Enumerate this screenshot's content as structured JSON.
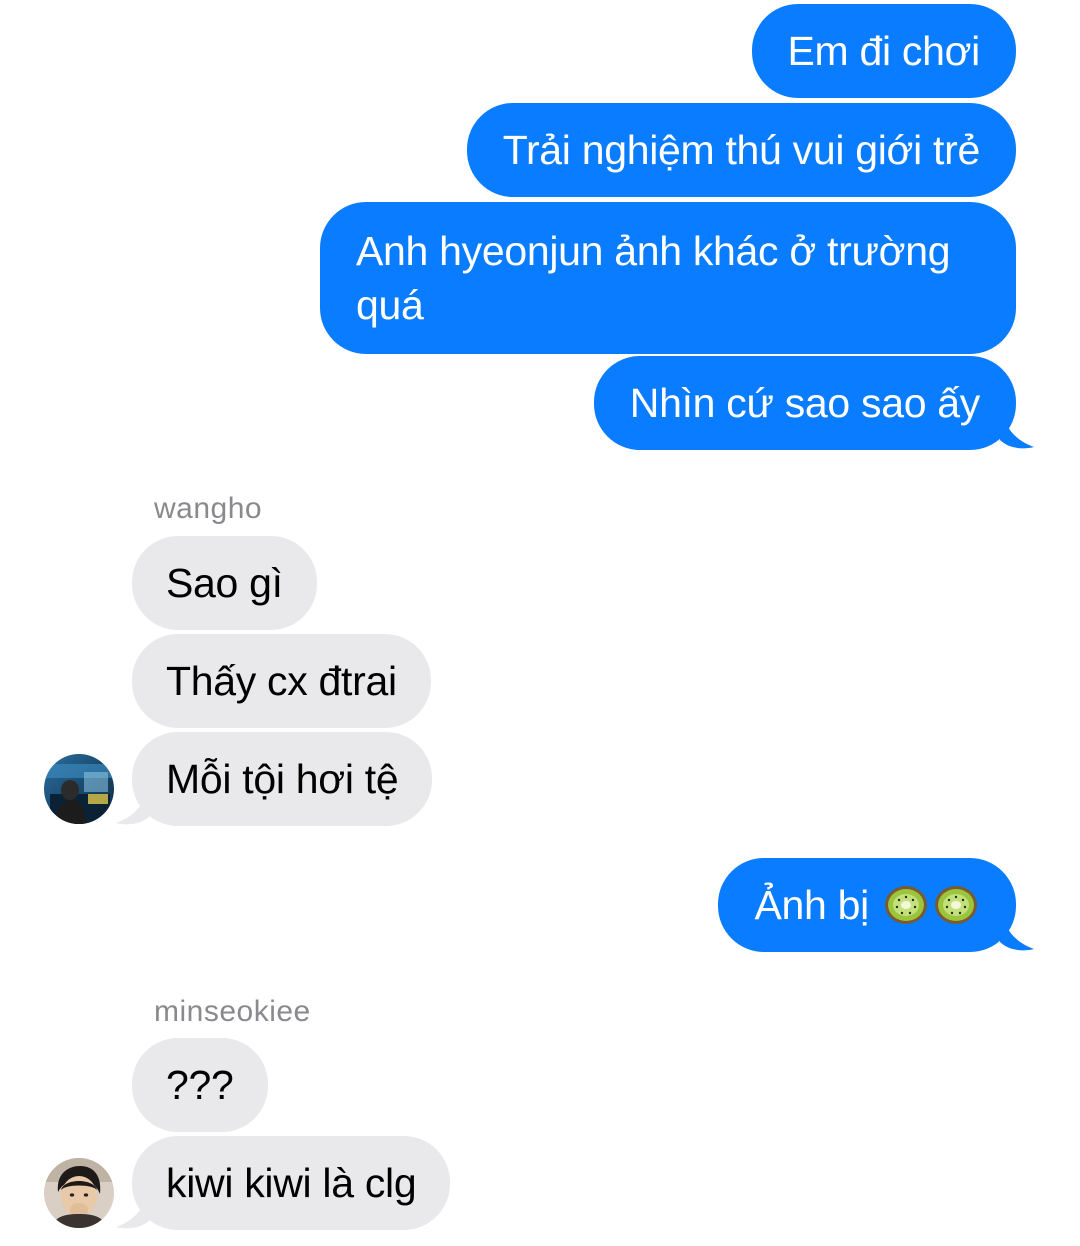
{
  "conversation": {
    "outgoing_1": [
      "Em đi chơi",
      "Trải nghiệm thú vui giới trẻ",
      "Anh hyeonjun ảnh khác ở trường quá",
      "Nhìn cứ sao sao ấy"
    ],
    "sender_1": "wangho",
    "incoming_1": [
      "Sao gì",
      "Thấy cx đtrai",
      "Mỗi tội hơi tệ"
    ],
    "outgoing_2_text": "Ảnh bị ",
    "outgoing_2_emoji": [
      "kiwi-emoji",
      "kiwi-emoji"
    ],
    "sender_2": "minseokiee",
    "incoming_2": [
      "???",
      "kiwi kiwi là clg"
    ]
  },
  "colors": {
    "outgoing_bubble": "#0a7cff",
    "incoming_bubble": "#e9e9eb",
    "sender_name": "#8a8a8e"
  }
}
